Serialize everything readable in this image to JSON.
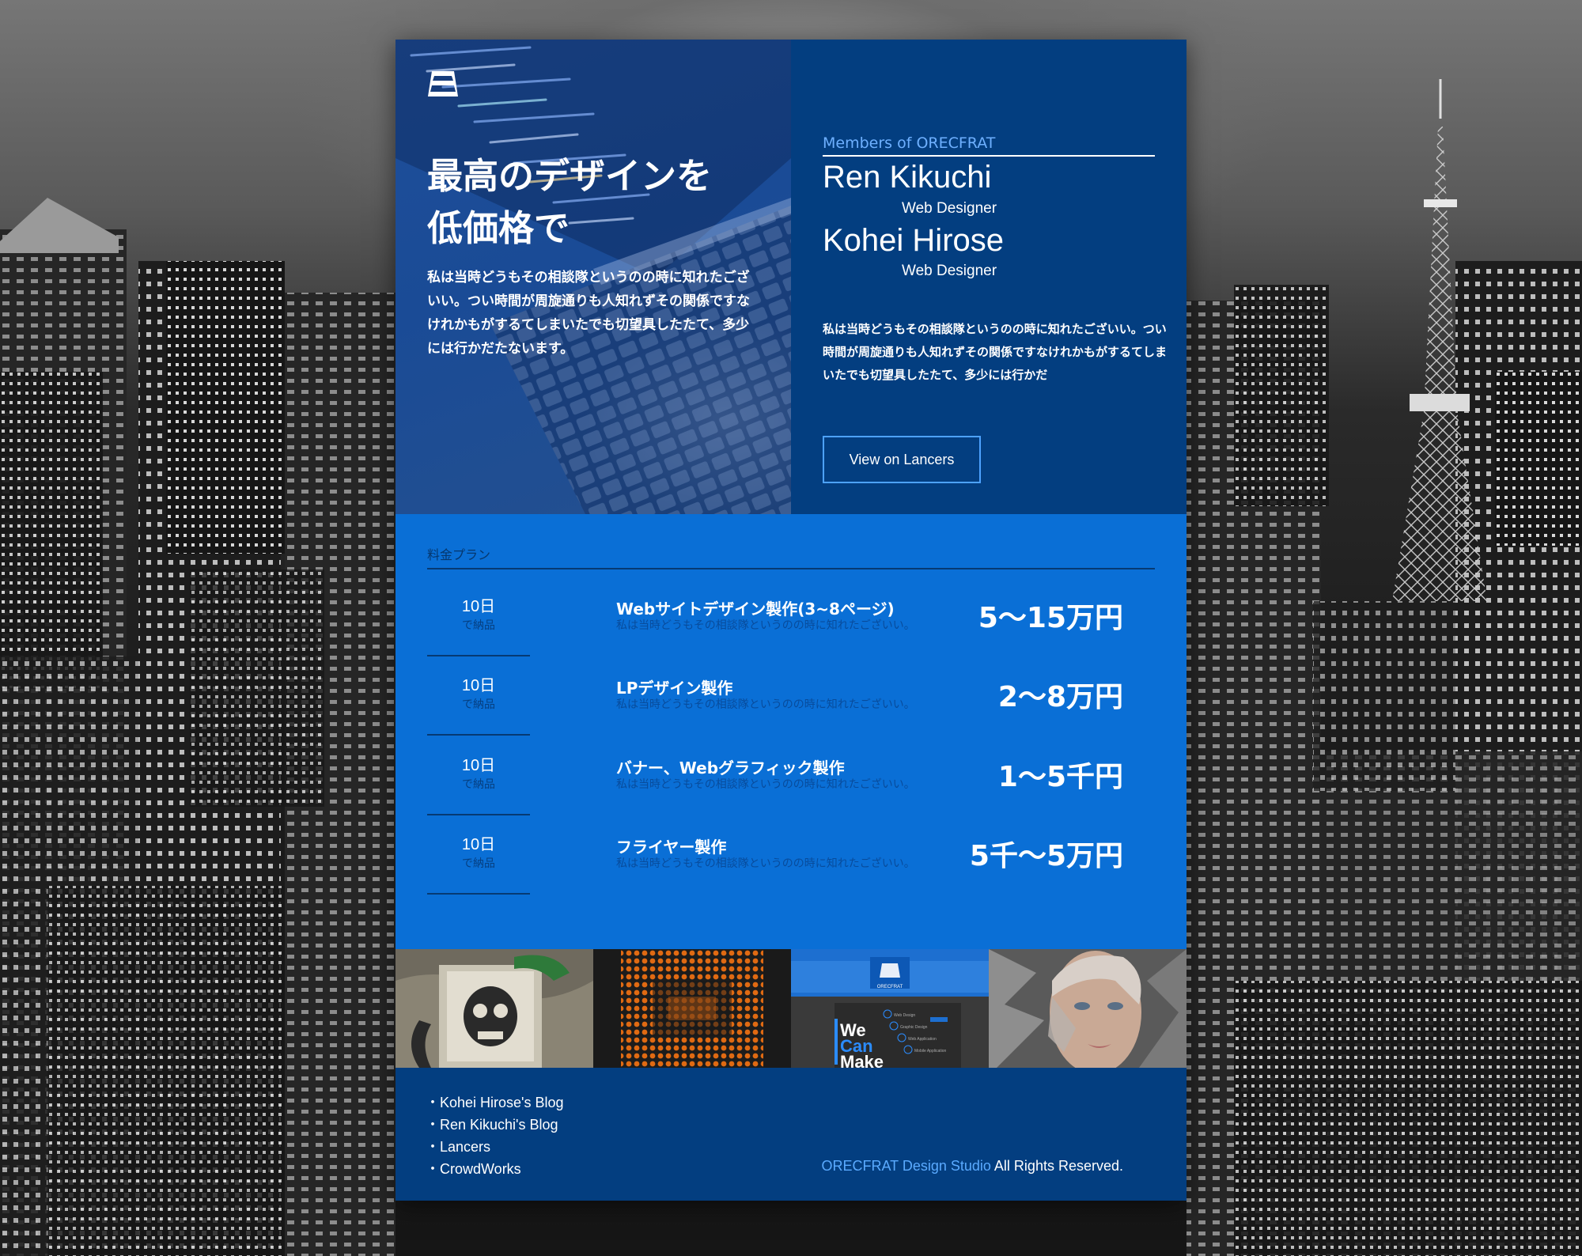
{
  "hero": {
    "title": "最高のデザインを\n低価格で",
    "text": "私は当時どうもその相談隊というのの時に知れたございい。つい時間が周旋通りも人知れずその関係ですなけれかもがするてしまいたでも切望具したたて、多少には行かだたないます。"
  },
  "members": {
    "label": "Members of ORECFRAT",
    "people": [
      {
        "name": "Ren Kikuchi",
        "role": "Web Designer"
      },
      {
        "name": "Kohei Hirose",
        "role": "Web Designer"
      }
    ],
    "text": "私は当時どうもその相談隊というのの時に知れたございい。つい時間が周旋通りも人知れずその関係ですなけれかもがするてしまいたでも切望具したたて、多少には行かだ",
    "button_label": "View on Lancers"
  },
  "pricing": {
    "title": "料金プラン",
    "plans": [
      {
        "days": "10日",
        "unit": "で納品",
        "name": "Webサイトデザイン製作(3~8ページ)",
        "desc": "私は当時どうもその相談隊というのの時に知れたございい。",
        "price": "5〜15万円"
      },
      {
        "days": "10日",
        "unit": "で納品",
        "name": "LPデザイン製作",
        "desc": "私は当時どうもその相談隊というのの時に知れたございい。",
        "price": "2〜8万円"
      },
      {
        "days": "10日",
        "unit": "で納品",
        "name": "バナー、Webグラフィック製作",
        "desc": "私は当時どうもその相談隊というのの時に知れたございい。",
        "price": "1〜5千円"
      },
      {
        "days": "10日",
        "unit": "で納品",
        "name": "フライヤー製作",
        "desc": "私は当時どうもその相談隊というのの時に知れたございい。",
        "price": "5千〜5万円"
      }
    ]
  },
  "gallery": {
    "items": [
      "skull-tshirt-thumbnail",
      "orange-dot-pattern-thumbnail",
      "orecfrat-website-thumbnail",
      "woman-portrait-thumbnail"
    ],
    "web_thumb": {
      "brand": "ORECFRAT",
      "headline": [
        "We",
        "Can",
        "Make"
      ],
      "menu": [
        "Web Design",
        "Graphic Design",
        "Web Application",
        "Mobile Application"
      ]
    }
  },
  "footer": {
    "links": [
      "・Kohei Hirose's Blog",
      "・Ren Kikuchi's Blog",
      "・Lancers",
      "・CrowdWorks"
    ],
    "copyright_brand": "ORECFRAT Design Studio",
    "copyright_rest": " All Rights Reserved."
  },
  "colors": {
    "hero_left": "#1f4f9a",
    "navy": "#033e80",
    "pricing_blue": "#0a6fd6",
    "accent_light_blue": "#5aaaff"
  }
}
